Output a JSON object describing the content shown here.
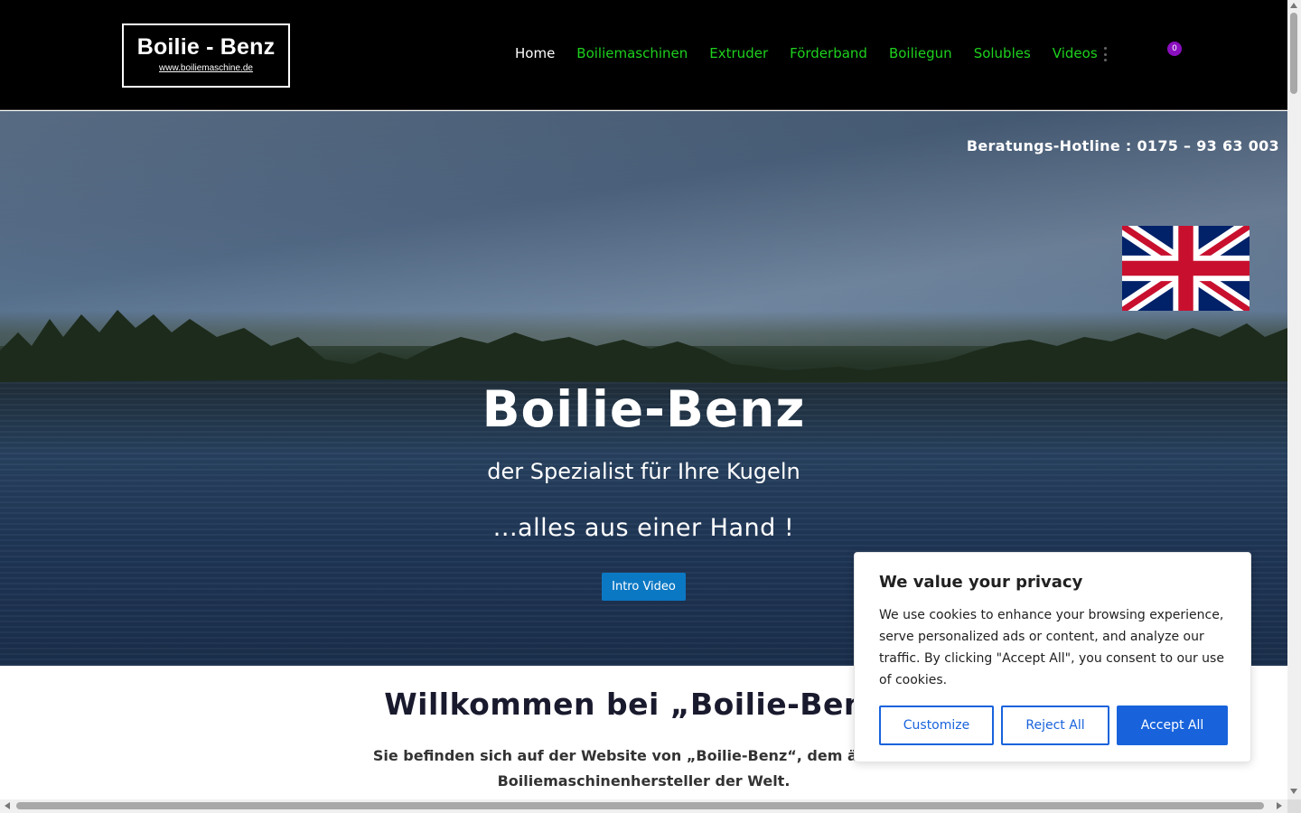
{
  "header": {
    "logo": {
      "title": "Boilie - Benz",
      "url": "www.boiliemaschine.de"
    },
    "nav": [
      {
        "label": "Home",
        "active": true
      },
      {
        "label": "Boiliemaschinen",
        "active": false
      },
      {
        "label": "Extruder",
        "active": false
      },
      {
        "label": "Förderband",
        "active": false
      },
      {
        "label": "Boiliegun",
        "active": false
      },
      {
        "label": "Solubles",
        "active": false
      },
      {
        "label": "Videos",
        "active": false
      }
    ],
    "more_icon": "vertical-dots-icon",
    "cart_icon": "shopping-cart-icon",
    "cart_count": "0",
    "colors": {
      "nav_link": "#1ed11e",
      "nav_active": "#ffffff",
      "badge": "#8a0fbf"
    }
  },
  "hero": {
    "hotline": "Beratungs-Hotline : 0175 – 93 63 003",
    "flag_icon": "uk-flag-icon",
    "title": "Boilie-Benz",
    "subtitle": "der Spezialist für Ihre Kugeln",
    "tagline": "...alles aus einer Hand !",
    "button_label": "Intro Video",
    "button_color": "#0b78c4"
  },
  "welcome": {
    "title": "Willkommen bei „Boilie-Benz“",
    "text": "Sie befinden sich auf der Website von „Boilie-Benz“, dem ältesten Boiliemaschinenhersteller der Welt."
  },
  "cookie_banner": {
    "title": "We value your privacy",
    "text": "We use cookies to enhance your browsing experience, serve personalized ads or content, and analyze our traffic. By clicking \"Accept All\", you consent to our use of cookies.",
    "customize_label": "Customize",
    "reject_label": "Reject All",
    "accept_label": "Accept All",
    "accent_color": "#1863dc"
  }
}
